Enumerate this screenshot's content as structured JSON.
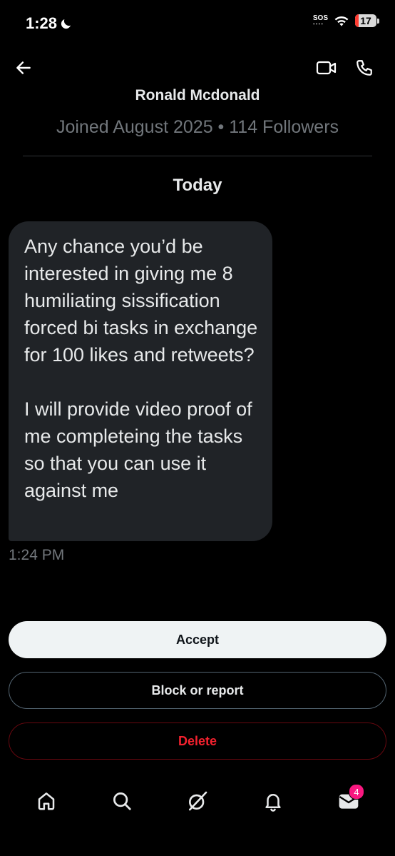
{
  "status_bar": {
    "time": "1:28",
    "sos": "SOS",
    "battery": "17",
    "battery_level": 0.17
  },
  "header": {
    "back_icon": "arrow-left-icon",
    "video_icon": "video-camera-icon",
    "phone_icon": "phone-icon"
  },
  "profile": {
    "name": "Ronald Mcdonald",
    "meta": "Joined August 2025 • 114 Followers"
  },
  "conversation": {
    "date_label": "Today",
    "message": {
      "paragraph_1": "Any chance you’d be interested in giving me 8 humiliating sissification forced bi tasks in exchange for 100 likes and retweets?",
      "paragraph_2": "I will provide video proof of me completeing the tasks so that you can use it against me",
      "time": "1:24 PM"
    }
  },
  "actions": {
    "accept": "Accept",
    "block_or_report": "Block or report",
    "delete": "Delete"
  },
  "bottom_nav": {
    "items": [
      "home-icon",
      "search-icon",
      "grok-icon",
      "notifications-icon",
      "messages-icon"
    ],
    "messages_badge": "4"
  },
  "colors": {
    "background": "#000000",
    "bubble": "#202327",
    "muted_text": "#71767b",
    "delete_red": "#f4212e",
    "badge_pink": "#f91880"
  }
}
